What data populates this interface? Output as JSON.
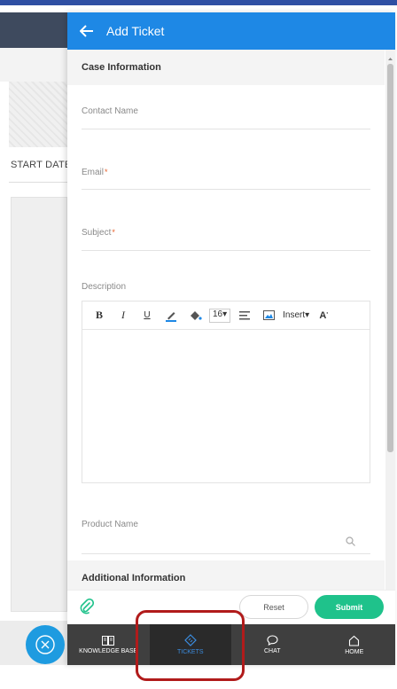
{
  "background": {
    "column_header": "START DATE"
  },
  "widget": {
    "title": "Add Ticket",
    "back_icon": "arrow-left-icon"
  },
  "sections": {
    "case_information": "Case Information",
    "additional_information": "Additional Information"
  },
  "fields": {
    "contact_name": {
      "label": "Contact Name",
      "required": false
    },
    "email": {
      "label": "Email",
      "required": true
    },
    "subject": {
      "label": "Subject",
      "required": true
    },
    "description": {
      "label": "Description"
    },
    "product_name": {
      "label": "Product Name",
      "required": false
    }
  },
  "required_marker": "*",
  "editor_toolbar": {
    "bold": "B",
    "italic": "I",
    "underline": "U",
    "font_size": "16",
    "insert": "Insert",
    "font_family": "A"
  },
  "actions": {
    "reset": "Reset",
    "submit": "Submit"
  },
  "bottom_nav": [
    {
      "label": "KNOWLEDGE BASE",
      "icon": "book-icon",
      "active": false
    },
    {
      "label": "TICKETS",
      "icon": "ticket-icon",
      "active": true
    },
    {
      "label": "CHAT",
      "icon": "chat-bubble-icon",
      "active": false
    },
    {
      "label": "HOME",
      "icon": "home-icon",
      "active": false
    }
  ],
  "colors": {
    "header": "#1e88e5",
    "submit": "#1fc28b",
    "nav_bar": "#3f3f3f",
    "active_nav": "#3b8de0",
    "required": "#e8612c",
    "highlight": "#b11b1b"
  }
}
